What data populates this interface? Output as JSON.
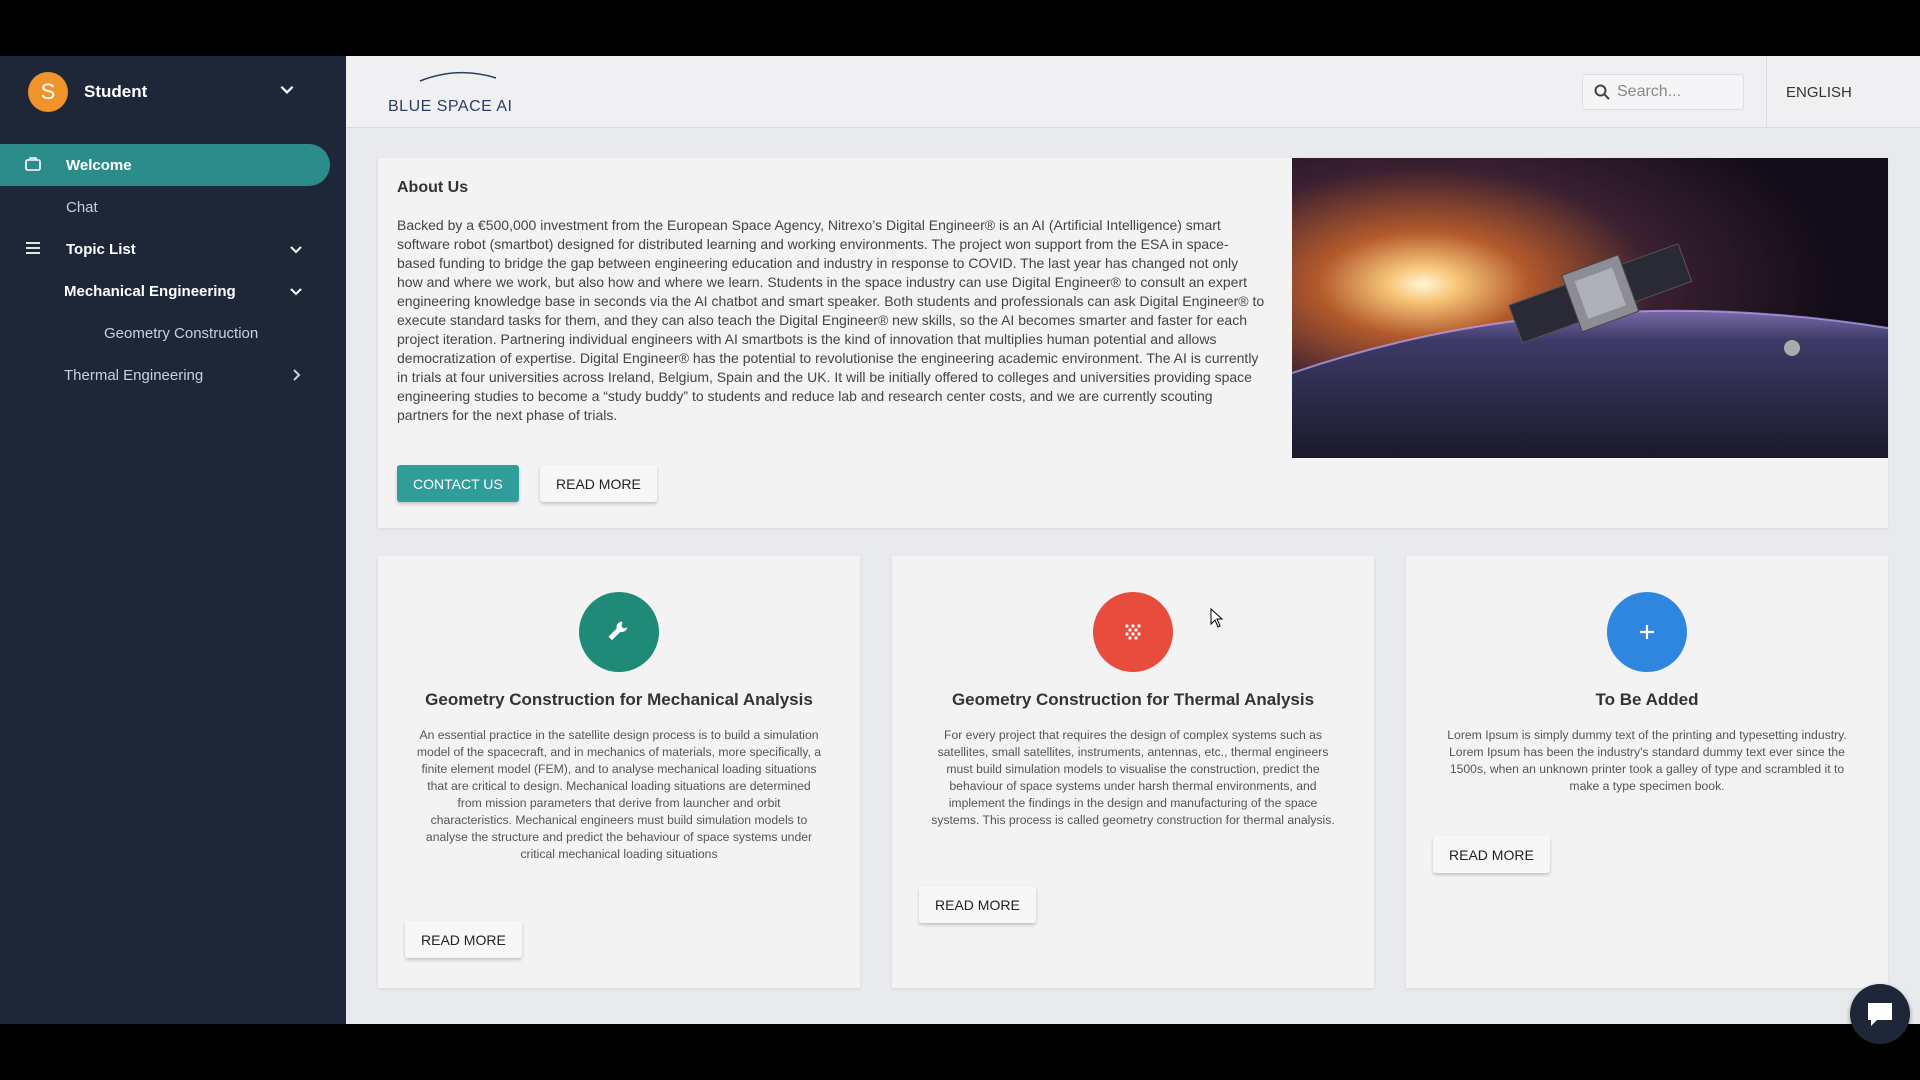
{
  "user": {
    "initial": "S",
    "name": "Student"
  },
  "sidebar": {
    "items": [
      {
        "label": "Welcome"
      },
      {
        "label": "Chat"
      },
      {
        "label": "Topic List"
      },
      {
        "label": "Mechanical Engineering"
      },
      {
        "label": "Geometry Construction"
      },
      {
        "label": "Thermal Engineering"
      }
    ]
  },
  "header": {
    "logo_text": "BLUE SPACE AI",
    "search_placeholder": "Search...",
    "language": "ENGLISH"
  },
  "about": {
    "title": "About Us",
    "body": "Backed by a €500,000 investment from the European Space Agency, Nitrexo’s Digital Engineer® is an AI (Artificial Intelligence) smart software robot (smartbot) designed for distributed learning and working environments. The project won support from the ESA in space-based funding to bridge the gap between engineering education and industry in response to COVID. The last year has changed not only how and where we work, but also how and where we learn. Students in the space industry can use Digital Engineer® to consult an expert engineering knowledge base in seconds via the AI chatbot and smart speaker. Both students and professionals can ask Digital Engineer® to execute standard tasks for them, and they can also teach the Digital Engineer® new skills, so the AI becomes smarter and faster for each project iteration. Partnering individual engineers with AI smartbots is the kind of innovation that multiplies human potential and allows democratization of expertise. Digital Engineer® has the potential to revolutionise the engineering academic environment. The AI is currently in trials at four universities across Ireland, Belgium, Spain and the UK. It will be initially offered to colleges and universities providing space engineering studies to become a “study buddy” to students and reduce lab and research center costs, and we are currently scouting partners for the next phase of trials.",
    "contact_label": "CONTACT US",
    "read_more_label": "READ MORE"
  },
  "cards": [
    {
      "icon": "wrench-icon",
      "color": "#1f8a78",
      "title": "Geometry Construction for Mechanical Analysis",
      "body": "An essential practice in the satellite design process is to build a simulation model of the spacecraft, and in mechanics of materials, more specifically, a finite element model (FEM), and to analyse mechanical loading situations that are critical to design. Mechanical loading situations are determined from mission parameters that derive from launcher and orbit characteristics. Mechanical engineers must build simulation models to analyse the structure and predict the behaviour of space systems under critical mechanical loading situations",
      "button": "READ MORE"
    },
    {
      "icon": "grain-icon",
      "color": "#e74c3c",
      "title": "Geometry Construction for Thermal Analysis",
      "body": "For every project that requires the design of complex systems such as satellites, small satellites, instruments, antennas, etc., thermal engineers must build simulation models to visualise the construction, predict the behaviour of space systems under harsh thermal environments, and implement the findings in the design and manufacturing of the space systems. This process is called geometry construction for thermal analysis.",
      "button": "READ MORE"
    },
    {
      "icon": "plus-icon",
      "color": "#2e86de",
      "title": "To Be Added",
      "body": "Lorem Ipsum is simply dummy text of the printing and typesetting industry. Lorem Ipsum has been the industry's standard dummy text ever since the 1500s, when an unknown printer took a galley of type and scrambled it to make a type specimen book.",
      "button": "READ MORE"
    }
  ]
}
